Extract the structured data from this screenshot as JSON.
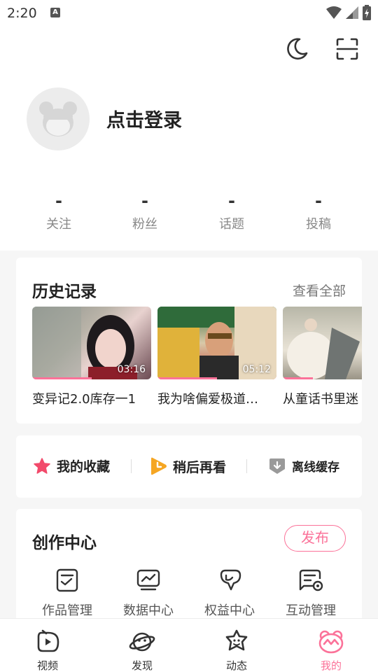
{
  "status_bar": {
    "time": "2:20",
    "notification_glyph": "A"
  },
  "profile": {
    "login_text": "点击登录",
    "stats": [
      {
        "value": "-",
        "label": "关注"
      },
      {
        "value": "-",
        "label": "粉丝"
      },
      {
        "value": "-",
        "label": "话题"
      },
      {
        "value": "-",
        "label": "投稿"
      }
    ]
  },
  "history": {
    "title": "历史记录",
    "view_all": "查看全部",
    "items": [
      {
        "title": "变异记2.0库存一1",
        "duration": "03:16",
        "progress": 0.5
      },
      {
        "title": "我为啥偏爱极道…",
        "duration": "05:12",
        "progress": 0.5
      },
      {
        "title": "从童话书里迷",
        "duration": "",
        "progress": 0.25
      }
    ]
  },
  "quick_actions": [
    {
      "label": "我的收藏",
      "icon": "star-icon"
    },
    {
      "label": "稍后再看",
      "icon": "watch-later-icon"
    },
    {
      "label": "离线缓存",
      "icon": "download-icon"
    }
  ],
  "creator": {
    "title": "创作中心",
    "publish_label": "发布",
    "tools": [
      {
        "label": "作品管理",
        "icon": "works-icon"
      },
      {
        "label": "数据中心",
        "icon": "data-chart-icon"
      },
      {
        "label": "权益中心",
        "icon": "rights-icon"
      },
      {
        "label": "互动管理",
        "icon": "interaction-icon"
      }
    ]
  },
  "bottom_nav": [
    {
      "label": "视频",
      "icon": "video-icon",
      "active": false
    },
    {
      "label": "发现",
      "icon": "planet-icon",
      "active": false
    },
    {
      "label": "动态",
      "icon": "dynamic-icon",
      "active": false
    },
    {
      "label": "我的",
      "icon": "mine-icon",
      "active": true
    }
  ],
  "colors": {
    "accent": "#fb7299",
    "quick_orange": "#f5a623",
    "star_red": "#f24a6b"
  }
}
